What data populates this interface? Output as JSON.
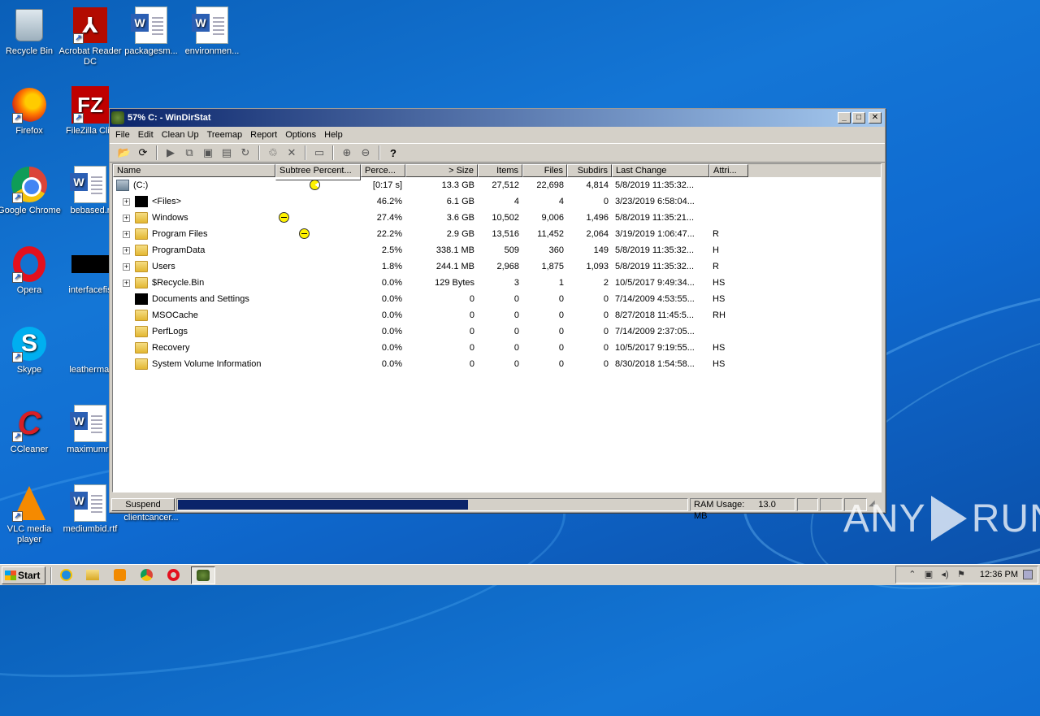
{
  "desktop": {
    "icons": [
      {
        "label": "Recycle Bin",
        "icon": "recycle-bin-icon"
      },
      {
        "label": "Acrobat Reader DC",
        "icon": "acrobat-icon"
      },
      {
        "label": "packagesm...",
        "icon": "word-doc-icon"
      },
      {
        "label": "environmen...",
        "icon": "word-doc-icon"
      },
      {
        "label": "Firefox",
        "icon": "firefox-icon"
      },
      {
        "label": "FileZilla Clie",
        "icon": "filezilla-icon"
      },
      {
        "label": "Google Chrome",
        "icon": "chrome-icon"
      },
      {
        "label": "bebased.r",
        "icon": "word-doc-icon"
      },
      {
        "label": "Opera",
        "icon": "opera-icon"
      },
      {
        "label": "interfacefis",
        "icon": "black-thumbnail-icon"
      },
      {
        "label": "Skype",
        "icon": "skype-icon"
      },
      {
        "label": "leathermal",
        "icon": "blank-file-icon"
      },
      {
        "label": "CCleaner",
        "icon": "ccleaner-icon"
      },
      {
        "label": "maximumre",
        "icon": "word-doc-icon"
      },
      {
        "label": "VLC media player",
        "icon": "vlc-icon"
      },
      {
        "label": "mediumbid.rtf",
        "icon": "word-doc-icon"
      },
      {
        "label": "clientcancer...",
        "icon": "word-doc-icon"
      }
    ]
  },
  "window": {
    "title": "57% C: - WinDirStat",
    "controls": {
      "minimize": "_",
      "maximize": "□",
      "close": "✕"
    },
    "menu": [
      "File",
      "Edit",
      "Clean Up",
      "Treemap",
      "Report",
      "Options",
      "Help"
    ],
    "columns": [
      "Name",
      "Subtree Percent...",
      "Perce...",
      "> Size",
      "Items",
      "Files",
      "Subdirs",
      "Last Change",
      "Attri..."
    ],
    "rows": [
      {
        "name": "(C:)",
        "subtree": 0.42,
        "pct": "[0:17 s]",
        "size": "13.3 GB",
        "items": "27,512",
        "files": "22,698",
        "subdirs": "4,814",
        "date": "5/8/2019 11:35:32...",
        "attr": "",
        "icon": "drive",
        "expander": false,
        "level": 0,
        "pacman": "busy"
      },
      {
        "name": "<Files>",
        "subtree": null,
        "pct": "46.2%",
        "size": "6.1 GB",
        "items": "4",
        "files": "4",
        "subdirs": "0",
        "date": "3/23/2019 6:58:04...",
        "attr": "",
        "icon": "black",
        "expander": true,
        "level": 1,
        "pacman": "none"
      },
      {
        "name": "Windows",
        "subtree": 0.0,
        "pct": "27.4%",
        "size": "3.6 GB",
        "items": "10,502",
        "files": "9,006",
        "subdirs": "1,496",
        "date": "5/8/2019 11:35:21...",
        "attr": "",
        "icon": "folder",
        "expander": true,
        "level": 1,
        "pacman": "done"
      },
      {
        "name": "Program Files",
        "subtree": 0.28,
        "pct": "22.2%",
        "size": "2.9 GB",
        "items": "13,516",
        "files": "11,452",
        "subdirs": "2,064",
        "date": "3/19/2019 1:06:47...",
        "attr": "R",
        "icon": "folder",
        "expander": true,
        "level": 1,
        "pacman": "done"
      },
      {
        "name": "ProgramData",
        "subtree": null,
        "pct": "2.5%",
        "size": "338.1 MB",
        "items": "509",
        "files": "360",
        "subdirs": "149",
        "date": "5/8/2019 11:35:32...",
        "attr": "H",
        "icon": "folder",
        "expander": true,
        "level": 1,
        "pacman": "none"
      },
      {
        "name": "Users",
        "subtree": null,
        "pct": "1.8%",
        "size": "244.1 MB",
        "items": "2,968",
        "files": "1,875",
        "subdirs": "1,093",
        "date": "5/8/2019 11:35:32...",
        "attr": "R",
        "icon": "folder",
        "expander": true,
        "level": 1,
        "pacman": "none"
      },
      {
        "name": "$Recycle.Bin",
        "subtree": null,
        "pct": "0.0%",
        "size": "129 Bytes",
        "items": "3",
        "files": "1",
        "subdirs": "2",
        "date": "10/5/2017 9:49:34...",
        "attr": "HS",
        "icon": "folder",
        "expander": true,
        "level": 1,
        "pacman": "none"
      },
      {
        "name": "Documents and Settings",
        "subtree": null,
        "pct": "0.0%",
        "size": "0",
        "items": "0",
        "files": "0",
        "subdirs": "0",
        "date": "7/14/2009 4:53:55...",
        "attr": "HS",
        "icon": "black",
        "expander": false,
        "level": 1,
        "pacman": "none"
      },
      {
        "name": "MSOCache",
        "subtree": null,
        "pct": "0.0%",
        "size": "0",
        "items": "0",
        "files": "0",
        "subdirs": "0",
        "date": "8/27/2018 11:45:5...",
        "attr": "RH",
        "icon": "folder",
        "expander": false,
        "level": 1,
        "pacman": "none"
      },
      {
        "name": "PerfLogs",
        "subtree": null,
        "pct": "0.0%",
        "size": "0",
        "items": "0",
        "files": "0",
        "subdirs": "0",
        "date": "7/14/2009 2:37:05...",
        "attr": "",
        "icon": "folder",
        "expander": false,
        "level": 1,
        "pacman": "none"
      },
      {
        "name": "Recovery",
        "subtree": null,
        "pct": "0.0%",
        "size": "0",
        "items": "0",
        "files": "0",
        "subdirs": "0",
        "date": "10/5/2017 9:19:55...",
        "attr": "HS",
        "icon": "folder",
        "expander": false,
        "level": 1,
        "pacman": "none"
      },
      {
        "name": "System Volume Information",
        "subtree": null,
        "pct": "0.0%",
        "size": "0",
        "items": "0",
        "files": "0",
        "subdirs": "0",
        "date": "8/30/2018 1:54:58...",
        "attr": "HS",
        "icon": "folder",
        "expander": false,
        "level": 1,
        "pacman": "none"
      }
    ],
    "status": {
      "suspend_label": "Suspend",
      "progress_fraction": 0.57,
      "ram_label": "RAM Usage:",
      "ram_value": "13.0 MB",
      "accent": "#0a246a"
    }
  },
  "taskbar": {
    "start_label": "Start",
    "quick_launch": [
      "ie-icon",
      "explorer-icon",
      "media-player-icon",
      "chrome-icon",
      "opera-icon"
    ],
    "active_task": "windirstat-task-icon",
    "clock": "12:36 PM"
  },
  "watermark": "ANY RUN"
}
